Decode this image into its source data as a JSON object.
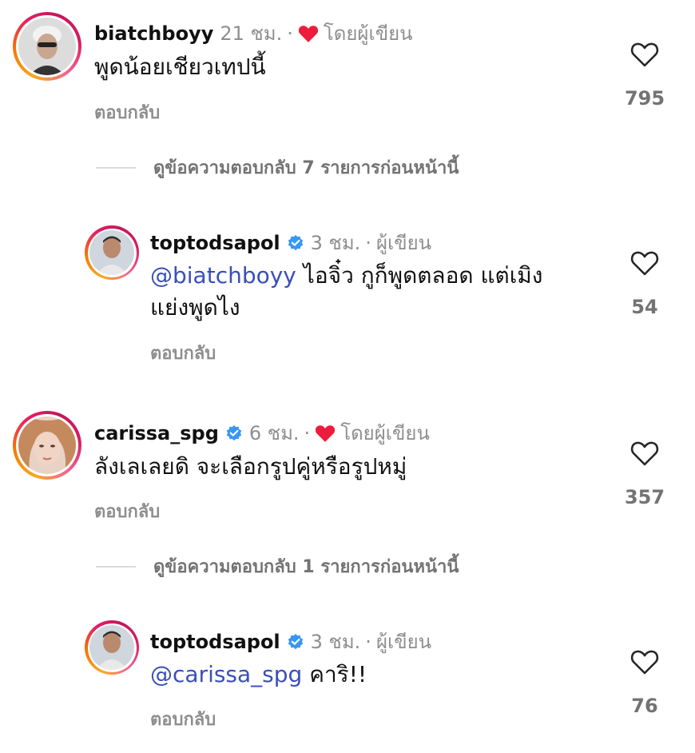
{
  "comments": [
    {
      "username": "biatchboyy",
      "time": "21 ชม.",
      "dot": "·",
      "author_tag": "โดยผู้เขียน",
      "text": "พูดน้อยเชียวเทปนี้",
      "reply_label": "ตอบกลับ",
      "likes": "795",
      "icons": {
        "like": "heart-outline-icon",
        "liked_by_author": "heart-filled-icon"
      },
      "colors": {
        "liked_heart": "#ed1c3c"
      }
    },
    {
      "username": "toptodsapol",
      "time": "3 ชม.",
      "dot": "·",
      "author_tag": "ผู้เขียน",
      "mention": "@biatchboyy",
      "text_line1": " ไอจิ๋ว กูก็พูดตลอด แต่เมิง",
      "text_line2": "แย่งพูดไง",
      "reply_label": "ตอบกลับ",
      "likes": "54",
      "icons": {
        "verified": "verified-badge-icon",
        "like": "heart-outline-icon"
      }
    },
    {
      "username": "carissa_spg",
      "time": "6 ชม.",
      "dot": "·",
      "author_tag": "โดยผู้เขียน",
      "text": "ลังเลเลยดิ จะเลือกรูปคู่หรือรูปหมู่",
      "reply_label": "ตอบกลับ",
      "likes": "357",
      "icons": {
        "verified": "verified-badge-icon",
        "like": "heart-outline-icon",
        "liked_by_author": "heart-filled-icon"
      }
    },
    {
      "username": "toptodsapol",
      "time": "3 ชม.",
      "dot": "·",
      "author_tag": "ผู้เขียน",
      "mention": "@carissa_spg",
      "text": " คาริ!!",
      "reply_label": "ตอบกลับ",
      "likes": "76",
      "icons": {
        "verified": "verified-badge-icon",
        "like": "heart-outline-icon"
      }
    }
  ],
  "view_replies": [
    {
      "label": "ดูข้อความตอบกลับ 7 รายการก่อนหน้านี้"
    },
    {
      "label": "ดูข้อความตอบกลับ 1 รายการก่อนหน้านี้"
    }
  ],
  "colors": {
    "mention": "#3a4fb7",
    "muted": "#8e8e8e",
    "verified": "#3897f0"
  }
}
